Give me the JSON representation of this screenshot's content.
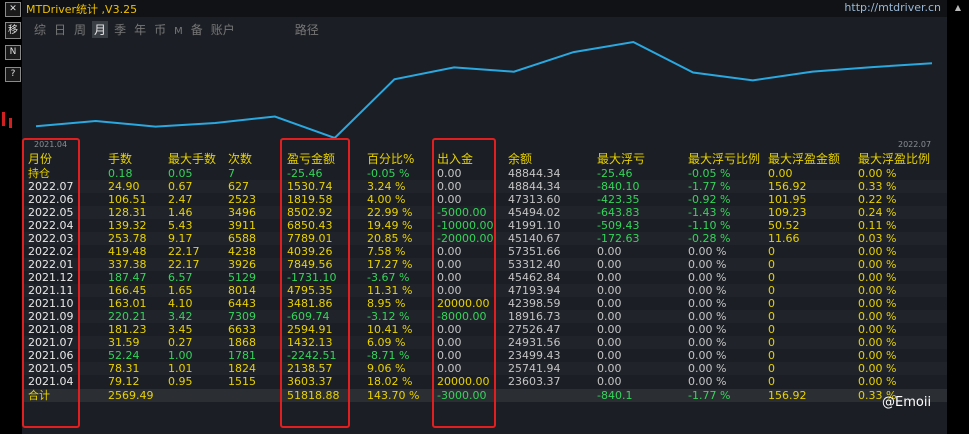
{
  "title": "MTDriver统计 ,V3.25",
  "site_link": "http://mtdriver.cn",
  "left_toolbar": [
    "✕",
    "移",
    "N",
    "?"
  ],
  "tabs": [
    {
      "label": "综",
      "active": false
    },
    {
      "label": "日",
      "active": false
    },
    {
      "label": "周",
      "active": false
    },
    {
      "label": "月",
      "active": true
    },
    {
      "label": "季",
      "active": false
    },
    {
      "label": "年",
      "active": false
    },
    {
      "label": "币",
      "active": false
    },
    {
      "label": "M",
      "active": false
    },
    {
      "label": "备",
      "active": false
    },
    {
      "label": "账户",
      "active": false
    },
    {
      "label": "路径",
      "active": false
    }
  ],
  "chart": {
    "start_label": "2021.04",
    "end_label": "2022.07",
    "line_color": "#2aa8e0",
    "values": [
      23603.37,
      25741.94,
      23499.43,
      24931.56,
      27526.47,
      18916.73,
      42398.59,
      47193.94,
      45462.84,
      53312.4,
      57351.66,
      45140.67,
      41991.1,
      45494.02,
      47313.6,
      48844.34
    ]
  },
  "table": {
    "headers": [
      "月份",
      "手数",
      "最大手数",
      "次数",
      "盈亏金额",
      "百分比%",
      "出入金",
      "余额",
      "最大浮亏",
      "最大浮亏比例",
      "最大浮盈金额",
      "最大浮盈比例"
    ],
    "holding": {
      "label": "持仓",
      "lots": "0.18",
      "max_lots": "0.05",
      "count": "7",
      "pnl": "-25.46",
      "pct": "-0.05 %",
      "flow": "0.00",
      "balance": "48844.34",
      "max_loss": "-25.46",
      "max_loss_pct": "-0.05 %",
      "max_gain": "0.00",
      "max_gain_pct": "0.00 %"
    },
    "rows": [
      {
        "month": "2022.07",
        "lots": "24.90",
        "max_lots": "0.67",
        "count": "627",
        "pnl": "1530.74",
        "pct": "3.24 %",
        "flow": "0.00",
        "balance": "48844.34",
        "max_loss": "-840.10",
        "max_loss_pct": "-1.77 %",
        "max_gain": "156.92",
        "max_gain_pct": "0.33 %"
      },
      {
        "month": "2022.06",
        "lots": "106.51",
        "max_lots": "2.47",
        "count": "2523",
        "pnl": "1819.58",
        "pct": "4.00 %",
        "flow": "0.00",
        "balance": "47313.60",
        "max_loss": "-423.35",
        "max_loss_pct": "-0.92 %",
        "max_gain": "101.95",
        "max_gain_pct": "0.22 %"
      },
      {
        "month": "2022.05",
        "lots": "128.31",
        "max_lots": "1.46",
        "count": "3496",
        "pnl": "8502.92",
        "pct": "22.99 %",
        "flow": "-5000.00",
        "balance": "45494.02",
        "max_loss": "-643.83",
        "max_loss_pct": "-1.43 %",
        "max_gain": "109.23",
        "max_gain_pct": "0.24 %"
      },
      {
        "month": "2022.04",
        "lots": "139.32",
        "max_lots": "5.43",
        "count": "3911",
        "pnl": "6850.43",
        "pct": "19.49 %",
        "flow": "-10000.00",
        "balance": "41991.10",
        "max_loss": "-509.43",
        "max_loss_pct": "-1.10 %",
        "max_gain": "50.52",
        "max_gain_pct": "0.11 %"
      },
      {
        "month": "2022.03",
        "lots": "253.78",
        "max_lots": "9.17",
        "count": "6588",
        "pnl": "7789.01",
        "pct": "20.85 %",
        "flow": "-20000.00",
        "balance": "45140.67",
        "max_loss": "-172.63",
        "max_loss_pct": "-0.28 %",
        "max_gain": "11.66",
        "max_gain_pct": "0.03 %"
      },
      {
        "month": "2022.02",
        "lots": "419.48",
        "max_lots": "22.17",
        "count": "4238",
        "pnl": "4039.26",
        "pct": "7.58 %",
        "flow": "0.00",
        "balance": "57351.66",
        "max_loss": "0.00",
        "max_loss_pct": "0.00 %",
        "max_gain": "0",
        "max_gain_pct": "0.00 %"
      },
      {
        "month": "2022.01",
        "lots": "337.38",
        "max_lots": "22.17",
        "count": "3926",
        "pnl": "7849.56",
        "pct": "17.27 %",
        "flow": "0.00",
        "balance": "53312.40",
        "max_loss": "0.00",
        "max_loss_pct": "0.00 %",
        "max_gain": "0",
        "max_gain_pct": "0.00 %"
      },
      {
        "month": "2021.12",
        "lots": "187.47",
        "max_lots": "6.57",
        "count": "5129",
        "pnl": "-1731.10",
        "pct": "-3.67 %",
        "flow": "0.00",
        "balance": "45462.84",
        "max_loss": "0.00",
        "max_loss_pct": "0.00 %",
        "max_gain": "0",
        "max_gain_pct": "0.00 %"
      },
      {
        "month": "2021.11",
        "lots": "166.45",
        "max_lots": "1.65",
        "count": "8014",
        "pnl": "4795.35",
        "pct": "11.31 %",
        "flow": "0.00",
        "balance": "47193.94",
        "max_loss": "0.00",
        "max_loss_pct": "0.00 %",
        "max_gain": "0",
        "max_gain_pct": "0.00 %"
      },
      {
        "month": "2021.10",
        "lots": "163.01",
        "max_lots": "4.10",
        "count": "6443",
        "pnl": "3481.86",
        "pct": "8.95 %",
        "flow": "20000.00",
        "balance": "42398.59",
        "max_loss": "0.00",
        "max_loss_pct": "0.00 %",
        "max_gain": "0",
        "max_gain_pct": "0.00 %"
      },
      {
        "month": "2021.09",
        "lots": "220.21",
        "max_lots": "3.42",
        "count": "7309",
        "pnl": "-609.74",
        "pct": "-3.12 %",
        "flow": "-8000.00",
        "balance": "18916.73",
        "max_loss": "0.00",
        "max_loss_pct": "0.00 %",
        "max_gain": "0",
        "max_gain_pct": "0.00 %"
      },
      {
        "month": "2021.08",
        "lots": "181.23",
        "max_lots": "3.45",
        "count": "6633",
        "pnl": "2594.91",
        "pct": "10.41 %",
        "flow": "0.00",
        "balance": "27526.47",
        "max_loss": "0.00",
        "max_loss_pct": "0.00 %",
        "max_gain": "0",
        "max_gain_pct": "0.00 %"
      },
      {
        "month": "2021.07",
        "lots": "31.59",
        "max_lots": "0.27",
        "count": "1868",
        "pnl": "1432.13",
        "pct": "6.09 %",
        "flow": "0.00",
        "balance": "24931.56",
        "max_loss": "0.00",
        "max_loss_pct": "0.00 %",
        "max_gain": "0",
        "max_gain_pct": "0.00 %"
      },
      {
        "month": "2021.06",
        "lots": "52.24",
        "max_lots": "1.00",
        "count": "1781",
        "pnl": "-2242.51",
        "pct": "-8.71 %",
        "flow": "0.00",
        "balance": "23499.43",
        "max_loss": "0.00",
        "max_loss_pct": "0.00 %",
        "max_gain": "0",
        "max_gain_pct": "0.00 %"
      },
      {
        "month": "2021.05",
        "lots": "78.31",
        "max_lots": "1.01",
        "count": "1824",
        "pnl": "2138.57",
        "pct": "9.06 %",
        "flow": "0.00",
        "balance": "25741.94",
        "max_loss": "0.00",
        "max_loss_pct": "0.00 %",
        "max_gain": "0",
        "max_gain_pct": "0.00 %"
      },
      {
        "month": "2021.04",
        "lots": "79.12",
        "max_lots": "0.95",
        "count": "1515",
        "pnl": "3603.37",
        "pct": "18.02 %",
        "flow": "20000.00",
        "balance": "23603.37",
        "max_loss": "0.00",
        "max_loss_pct": "0.00 %",
        "max_gain": "0",
        "max_gain_pct": "0.00 %"
      }
    ],
    "total": {
      "label": "合计",
      "lots": "2569.49",
      "max_lots": "",
      "count": "",
      "pnl": "51818.88",
      "pct": "143.70 %",
      "flow": "-3000.00",
      "balance": "",
      "max_loss": "-840.1",
      "max_loss_pct": "-1.77 %",
      "max_gain": "156.92",
      "max_gain_pct": "0.33 %"
    }
  },
  "watermark": "@Emoii",
  "colors": {
    "yellow": "#e8d200",
    "green": "#35d45b",
    "gray": "#c4c4c4",
    "highlight": "#e02020"
  }
}
